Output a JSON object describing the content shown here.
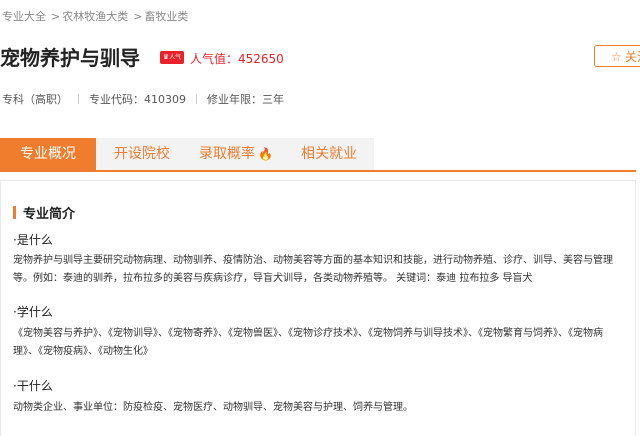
{
  "breadcrumb": {
    "items": [
      "专业大全",
      "农林牧渔大类",
      "畜牧业类"
    ],
    "separator": ">"
  },
  "header": {
    "title": "宠物养护与驯导",
    "hot_badge": "人气",
    "popularity": "人气值：452650",
    "follow_label": "关注"
  },
  "meta": {
    "level": "专科（高职）",
    "code": "专业代码：410309",
    "duration": "修业年限：三年"
  },
  "tabs": [
    {
      "label": "专业概况",
      "active": true
    },
    {
      "label": "开设院校",
      "active": false
    },
    {
      "label": "录取概率",
      "active": false,
      "icon": "fire-icon"
    },
    {
      "label": "相关就业",
      "active": false
    }
  ],
  "intro": {
    "section_title": "专业简介",
    "what_q": "·是什么",
    "what_a": "宠物养护与驯导主要研究动物病理、动物驯养、疫情防治、动物美容等方面的基本知识和技能，进行动物养殖、诊疗、训导、美容与管理等。例如：泰迪的驯养，拉布拉多的美容与疾病诊疗，导盲犬训导，各类动物养殖等。 关键词：泰迪 拉布拉多 导盲犬",
    "learn_q": "·学什么",
    "learn_a": "《宠物美容与养护》、《宠物训导》、《宠物寄养》、《宠物兽医》、《宠物诊疗技术》、《宠物饲养与训导技术》、《宠物繁育与饲养》、《宠物病理》、《宠物疫病》、《动物生化》",
    "do_q": "·干什么",
    "do_a": "动物类企业、事业单位：防疫检疫、宠物医疗、动物驯导、宠物美容与护理、饲养与管理。"
  },
  "colors": {
    "accent": "#f07c2e",
    "hot": "#e8212a"
  }
}
